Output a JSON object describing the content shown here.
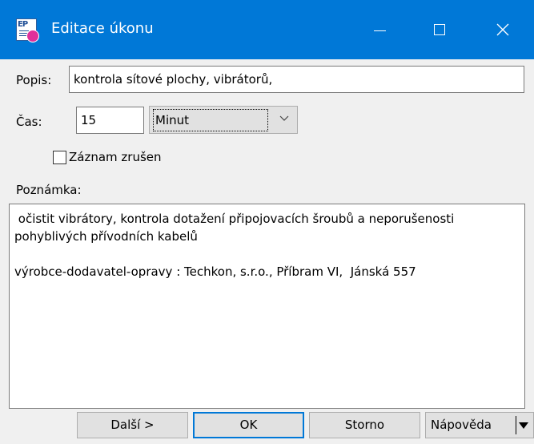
{
  "window": {
    "title": "Editace úkonu",
    "app_icon_text": "EP"
  },
  "form": {
    "popis_label": "Popis:",
    "popis_value": "kontrola sítové plochy,  vibrátorů,",
    "cas_label": "Čas:",
    "cas_value": "15",
    "cas_unit_selected": "Minut",
    "zaznam_zrusen_label": "Záznam zrušen",
    "zaznam_zrusen_checked": false,
    "poznamka_label": "Poznámka:",
    "poznamka_lines": [
      " očistit vibrátory, kontrola dotažení připojovacích šroubů a neporušenosti",
      "pohyblivých přívodních kabelů",
      "výrobce-dodavatel-opravy : Techkon, s.r.o., Příbram VI,  Jánská 557"
    ]
  },
  "buttons": {
    "dalsi": "Další >",
    "ok": "OK",
    "storno": "Storno",
    "napoveda": "Nápověda"
  }
}
